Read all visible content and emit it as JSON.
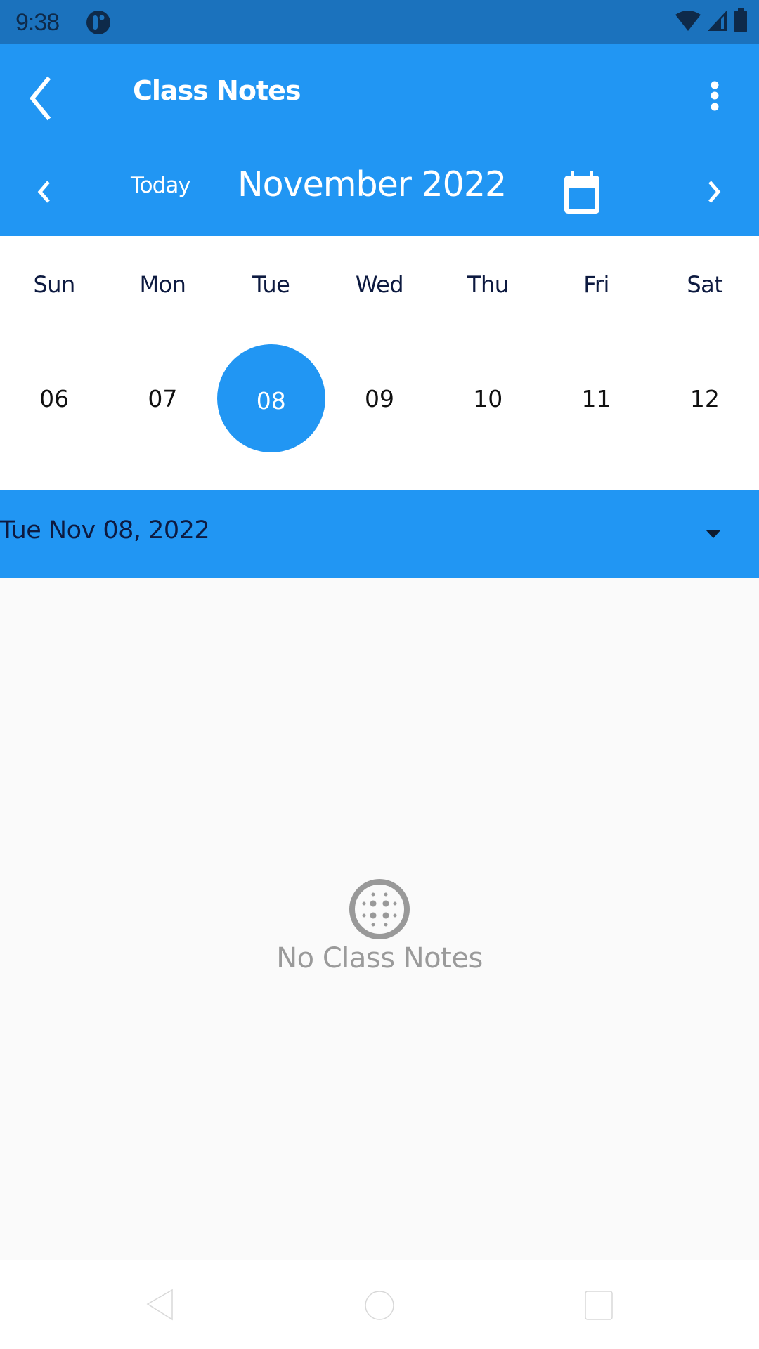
{
  "status_bar": {
    "time": "9:38",
    "icons": [
      "app-notification-icon",
      "wifi-icon",
      "cell-signal-icon",
      "battery-icon"
    ]
  },
  "app_bar": {
    "title": "Class Notes",
    "back_icon": "chevron-left-icon",
    "menu_icon": "more-vert-icon"
  },
  "calendar_nav": {
    "prev_icon": "chevron-left-icon",
    "today_label": "Today",
    "month_label": "November 2022",
    "calendar_icon": "calendar-icon",
    "next_icon": "chevron-right-icon"
  },
  "week": {
    "weekdays": [
      "Sun",
      "Mon",
      "Tue",
      "Wed",
      "Thu",
      "Fri",
      "Sat"
    ],
    "dates": [
      "06",
      "07",
      "08",
      "09",
      "10",
      "11",
      "12"
    ],
    "selected_index": 2
  },
  "date_dropdown": {
    "label": "Tue Nov 08, 2022",
    "icon": "arrow-drop-down-icon"
  },
  "empty_state": {
    "icon": "empty-notes-icon",
    "text": "No Class Notes"
  },
  "nav_bar": {
    "buttons": [
      "back",
      "home",
      "recents"
    ]
  },
  "colors": {
    "primary": "#2196f3",
    "status_bar": "#1b72bd",
    "text_dark": "#0d1a40",
    "empty_text": "#9a9a9a",
    "background": "#fafafa"
  }
}
